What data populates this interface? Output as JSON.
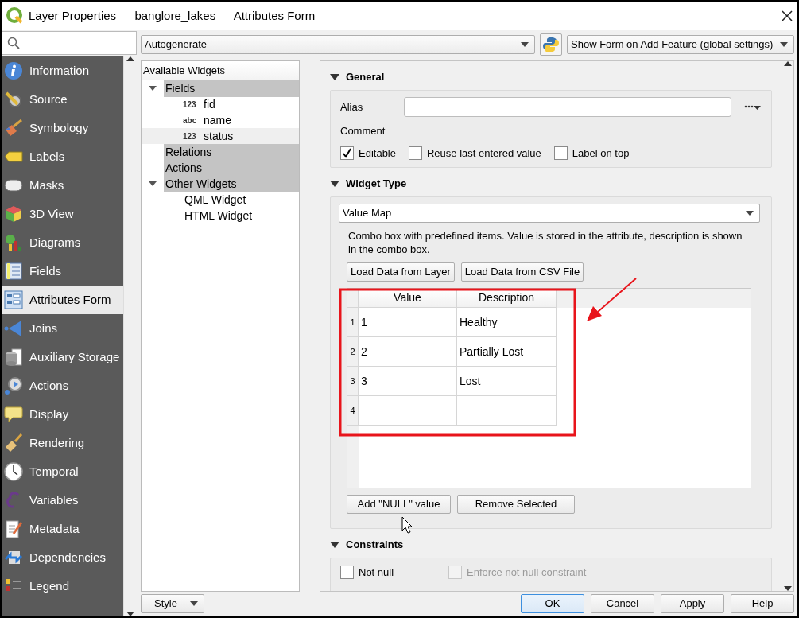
{
  "window": {
    "title": "Layer Properties — banglore_lakes — Attributes Form"
  },
  "sidebar": {
    "items": [
      {
        "label": "Information",
        "selected": false
      },
      {
        "label": "Source",
        "selected": false
      },
      {
        "label": "Symbology",
        "selected": false
      },
      {
        "label": "Labels",
        "selected": false
      },
      {
        "label": "Masks",
        "selected": false
      },
      {
        "label": "3D View",
        "selected": false
      },
      {
        "label": "Diagrams",
        "selected": false
      },
      {
        "label": "Fields",
        "selected": false
      },
      {
        "label": "Attributes Form",
        "selected": true
      },
      {
        "label": "Joins",
        "selected": false
      },
      {
        "label": "Auxiliary Storage",
        "selected": false
      },
      {
        "label": "Actions",
        "selected": false
      },
      {
        "label": "Display",
        "selected": false
      },
      {
        "label": "Rendering",
        "selected": false
      },
      {
        "label": "Temporal",
        "selected": false
      },
      {
        "label": "Variables",
        "selected": false
      },
      {
        "label": "Metadata",
        "selected": false
      },
      {
        "label": "Dependencies",
        "selected": false
      },
      {
        "label": "Legend",
        "selected": false
      }
    ]
  },
  "toolbar": {
    "layout_combo": "Autogenerate",
    "show_form_combo": "Show Form on Add Feature (global settings)"
  },
  "widget_tree": {
    "header": "Available Widgets",
    "items": [
      {
        "label": "Fields",
        "kind": "group",
        "expanded": true,
        "children": [
          {
            "label": "fid",
            "kind": "field",
            "type_label": "123",
            "selected": false
          },
          {
            "label": "name",
            "kind": "field",
            "type_label": "abc",
            "selected": false
          },
          {
            "label": "status",
            "kind": "field",
            "type_label": "123",
            "selected": true
          }
        ]
      },
      {
        "label": "Relations",
        "kind": "group"
      },
      {
        "label": "Actions",
        "kind": "group"
      },
      {
        "label": "Other Widgets",
        "kind": "group",
        "expanded": true,
        "children": [
          {
            "label": "QML Widget",
            "kind": "widget",
            "selected": false
          },
          {
            "label": "HTML Widget",
            "kind": "widget",
            "selected": false
          }
        ]
      }
    ]
  },
  "general": {
    "title": "General",
    "expanded": true,
    "alias_label": "Alias",
    "comment_label": "Comment",
    "checkboxes": [
      {
        "label": "Editable",
        "checked": true
      },
      {
        "label": "Reuse last entered value",
        "checked": false
      },
      {
        "label": "Label on top",
        "checked": false
      }
    ]
  },
  "widget_type": {
    "title": "Widget Type",
    "expanded": true,
    "combo": "Value Map",
    "description": "Combo box with predefined items. Value is stored in the attribute, description is shown in the combo box.",
    "load_buttons": [
      "Load Data from Layer",
      "Load Data from CSV File"
    ],
    "table": {
      "columns": [
        "Value",
        "Description"
      ],
      "rows": [
        {
          "number": "1",
          "value": "1",
          "description": "Healthy"
        },
        {
          "number": "2",
          "value": "2",
          "description": "Partially Lost"
        },
        {
          "number": "3",
          "value": "3",
          "description": "Lost"
        },
        {
          "number": "4"
        }
      ]
    },
    "buttons": [
      "Add \"NULL\" value",
      "Remove Selected"
    ]
  },
  "constraints": {
    "title": "Constraints",
    "expanded": true,
    "checkboxes": [
      {
        "label": "Not null",
        "checked": false,
        "disabled": false
      },
      {
        "label": "Enforce not null constraint",
        "checked": false,
        "disabled": true
      }
    ]
  },
  "footer": {
    "style_button": "Style",
    "buttons": [
      {
        "label": "OK",
        "default": true
      },
      {
        "label": "Cancel",
        "default": false
      },
      {
        "label": "Apply",
        "default": false
      },
      {
        "label": "Help",
        "default": false
      }
    ]
  }
}
